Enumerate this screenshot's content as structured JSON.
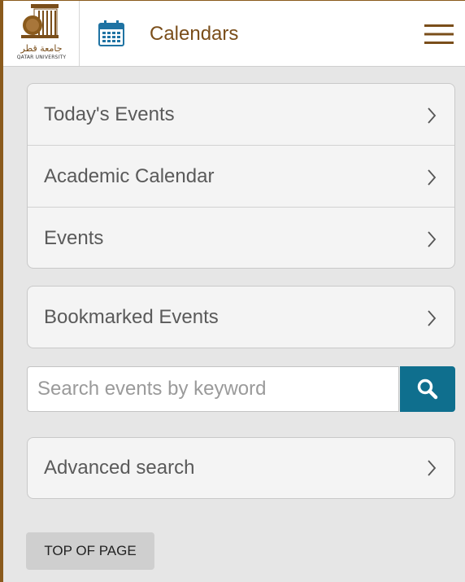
{
  "header": {
    "title": "Calendars",
    "logo_arabic": "جامعة قطر",
    "logo_english": "QATAR UNIVERSITY",
    "calendar_icon": "calendar-icon",
    "menu_icon": "hamburger-menu-icon"
  },
  "nav_groups": [
    {
      "items": [
        {
          "label": "Today's Events"
        },
        {
          "label": "Academic Calendar"
        },
        {
          "label": "Events"
        }
      ]
    },
    {
      "items": [
        {
          "label": "Bookmarked Events"
        }
      ]
    }
  ],
  "search": {
    "placeholder": "Search events by keyword",
    "value": "",
    "button_icon": "search-icon"
  },
  "advanced": {
    "label": "Advanced search"
  },
  "footer": {
    "top_of_page_label": "TOP OF PAGE"
  },
  "colors": {
    "brand_brown": "#7a4e1a",
    "search_button": "#0f6f8e",
    "background": "#e6e6e6"
  }
}
